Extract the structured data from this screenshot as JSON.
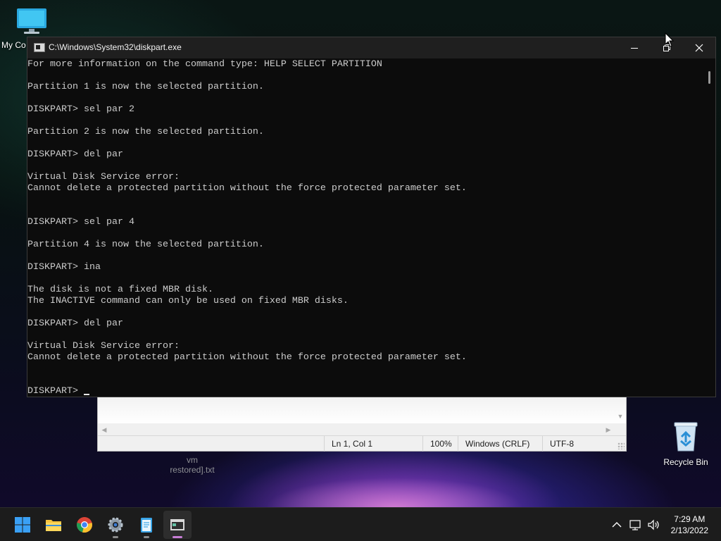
{
  "desktop": {
    "icons": {
      "my_computer": "My Co",
      "recycle_bin": "Recycle Bin",
      "text_file": "vm restored].txt"
    }
  },
  "console": {
    "title": "C:\\Windows\\System32\\diskpart.exe",
    "lines": [
      "For more information on the command type: HELP SELECT PARTITION",
      "",
      "Partition 1 is now the selected partition.",
      "",
      "DISKPART> sel par 2",
      "",
      "Partition 2 is now the selected partition.",
      "",
      "DISKPART> del par",
      "",
      "Virtual Disk Service error:",
      "Cannot delete a protected partition without the force protected parameter set.",
      "",
      "",
      "DISKPART> sel par 4",
      "",
      "Partition 4 is now the selected partition.",
      "",
      "DISKPART> ina",
      "",
      "The disk is not a fixed MBR disk.",
      "The INACTIVE command can only be used on fixed MBR disks.",
      "",
      "DISKPART> del par",
      "",
      "Virtual Disk Service error:",
      "Cannot delete a protected partition without the force protected parameter set.",
      "",
      ""
    ],
    "prompt": "DISKPART> "
  },
  "notepad": {
    "status": {
      "position": "Ln 1, Col 1",
      "zoom": "100%",
      "line_ending": "Windows (CRLF)",
      "encoding": "UTF-8"
    }
  },
  "taskbar": {
    "apps": [
      "start-icon",
      "file-explorer-icon",
      "chrome-icon",
      "settings-icon",
      "notepad-icon",
      "terminal-icon"
    ],
    "time": "7:29 AM",
    "date": "2/13/2022"
  },
  "colors": {
    "console_bg": "#0c0c0c",
    "console_text": "#cccccc",
    "titlebar_bg": "#1f1f1f",
    "taskbar_bg": "#1c1c1c",
    "active_indicator": "#c77dd6"
  }
}
